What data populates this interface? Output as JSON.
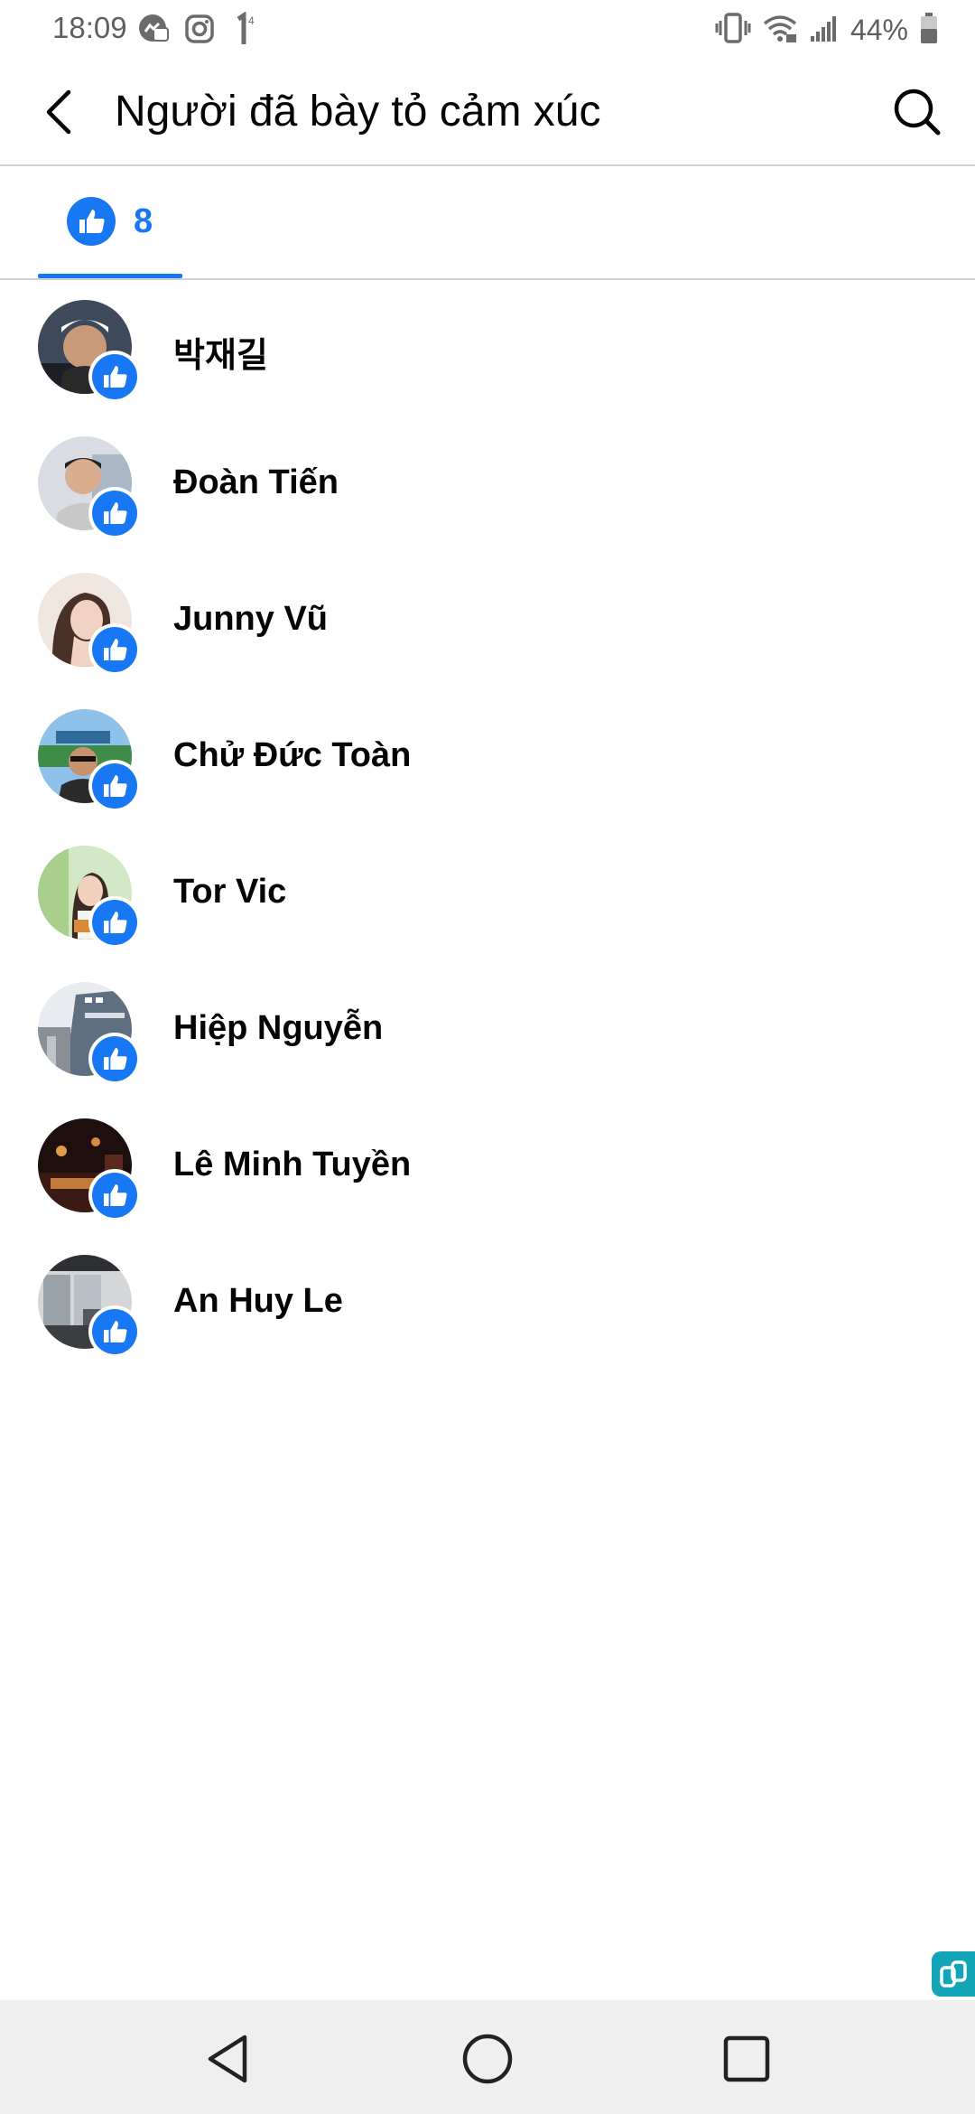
{
  "status_bar": {
    "time": "18:09",
    "notification_icons": [
      "messenger-icon",
      "instagram-icon",
      "sim-1-icon"
    ],
    "system_icons": [
      "vibrate-icon",
      "wifi-icon",
      "signal-icon",
      "battery-icon"
    ],
    "battery": "44%"
  },
  "header": {
    "back_icon": "back-arrow-icon",
    "title": "Người đã bày tỏ cảm xúc",
    "search_icon": "search-icon"
  },
  "tabs": {
    "active": {
      "icon": "like-reaction-icon",
      "count": "8"
    }
  },
  "colors": {
    "accent": "#1877f2",
    "divider": "#cfd2d6",
    "nav_bg": "#efefef"
  },
  "reactors": [
    {
      "name": "박재길",
      "reaction": "like"
    },
    {
      "name": "Đoàn Tiến",
      "reaction": "like"
    },
    {
      "name": "Junny Vũ",
      "reaction": "like"
    },
    {
      "name": "Chử Đức Toàn",
      "reaction": "like"
    },
    {
      "name": "Tor Vic",
      "reaction": "like"
    },
    {
      "name": "Hiệp Nguyễn",
      "reaction": "like"
    },
    {
      "name": "Lê Minh Tuyền",
      "reaction": "like"
    },
    {
      "name": "An Huy Le",
      "reaction": "like"
    }
  ],
  "nav_bar": {
    "buttons": [
      "back-triangle-icon",
      "home-circle-icon",
      "recents-square-icon"
    ]
  }
}
